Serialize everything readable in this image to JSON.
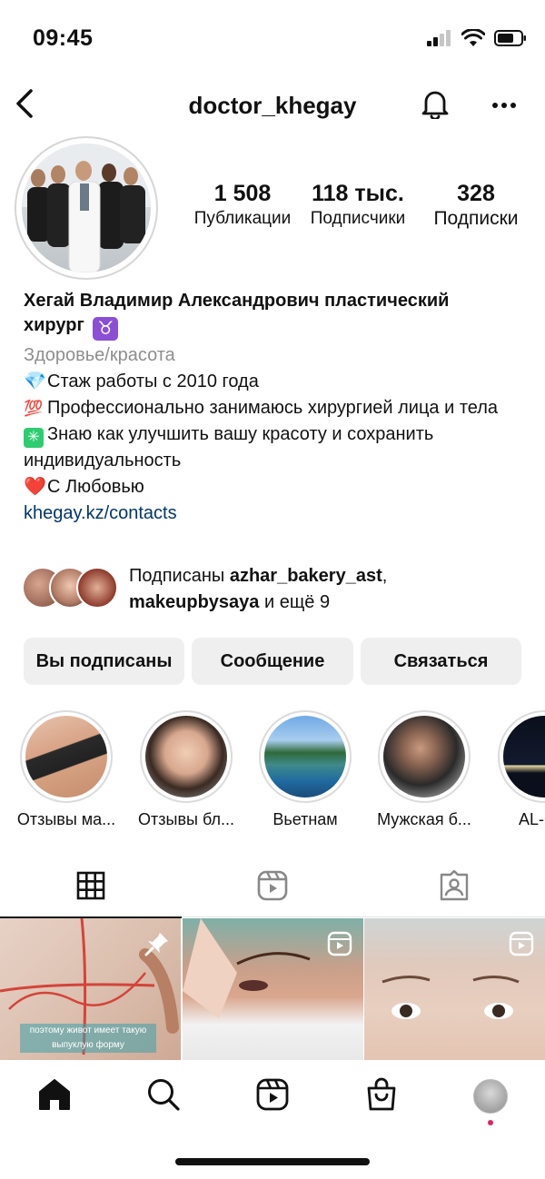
{
  "status_bar": {
    "time": "09:45"
  },
  "header": {
    "username": "doctor_khegay"
  },
  "stats": [
    {
      "value": "1 508",
      "label": "Публикации"
    },
    {
      "value": "118 тыс.",
      "label": "Подписчики"
    },
    {
      "value": "328",
      "label": "Подписки"
    }
  ],
  "bio": {
    "name_line1": "Хегай Владимир Александрович пластический",
    "name_line2": "хирург",
    "name_emoji": "♉",
    "category": "Здоровье/красота",
    "lines": [
      {
        "emoji": "💎",
        "text": "Стаж работы с 2010 года"
      },
      {
        "emoji": "💯",
        "text": "Профессионально занимаюсь хирургией лица и тела"
      },
      {
        "emoji": "✳",
        "text": "Знаю как улучшить вашу красоту и сохранить индивидуальность"
      },
      {
        "emoji": "❤️",
        "text": "С Любовью"
      }
    ],
    "link": "khegay.kz/contacts"
  },
  "followed_by": {
    "prefix": "Подписаны",
    "user1": "azhar_bakery_ast",
    "user2": "makeupbysaya",
    "suffix": "и ещё 9"
  },
  "buttons": {
    "following": "Вы подписаны",
    "message": "Сообщение",
    "contact": "Связаться"
  },
  "highlights": [
    {
      "label": "Отзывы ма..."
    },
    {
      "label": "Отзывы бл..."
    },
    {
      "label": "Вьетнам"
    },
    {
      "label": "Мужская б..."
    },
    {
      "label": "AL-CLI"
    }
  ],
  "grid": [
    {
      "caption": "поэтому живот имеет такую выпуклую форму"
    },
    {
      "caption": ""
    },
    {
      "caption": ""
    }
  ]
}
